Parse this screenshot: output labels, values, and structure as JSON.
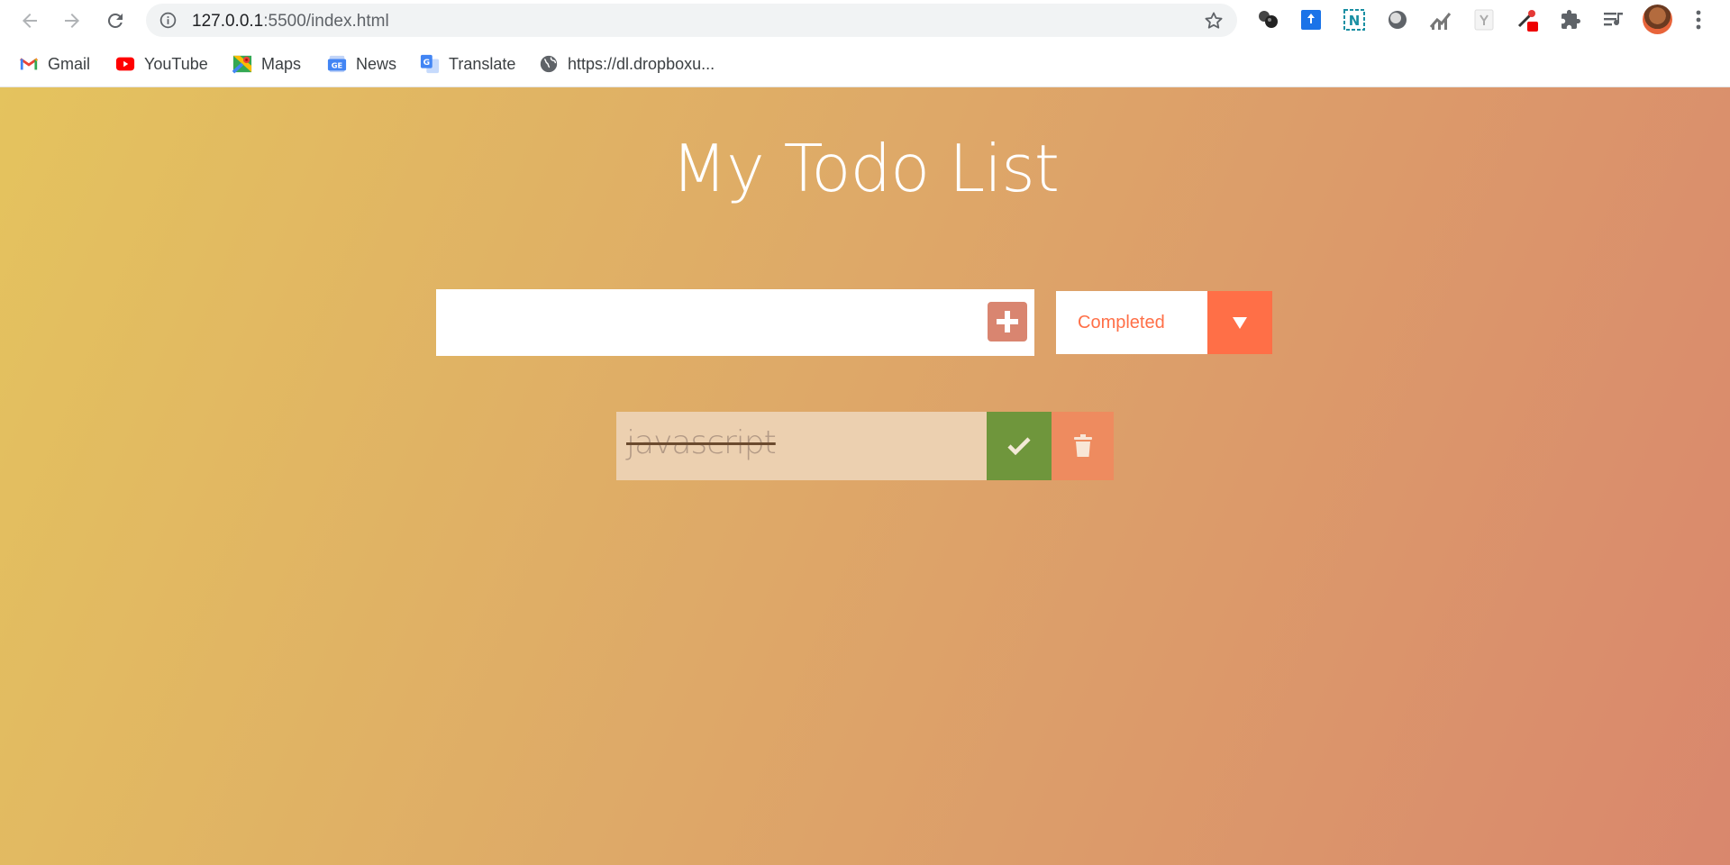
{
  "browser": {
    "url_host": "127.0.0.1",
    "url_rest": ":5500/index.html",
    "bookmarks": [
      {
        "label": "Gmail",
        "icon": "gmail-icon"
      },
      {
        "label": "YouTube",
        "icon": "youtube-icon"
      },
      {
        "label": "Maps",
        "icon": "maps-icon"
      },
      {
        "label": "News",
        "icon": "news-icon"
      },
      {
        "label": "Translate",
        "icon": "translate-icon"
      },
      {
        "label": "https://dl.dropboxu...",
        "icon": "globe-icon"
      }
    ]
  },
  "app": {
    "title": "My Todo List",
    "input_value": "",
    "filter_selected": "Completed",
    "todos": [
      {
        "text": "javascript",
        "completed": true
      }
    ]
  },
  "colors": {
    "gradient_start": "#e4c35e",
    "gradient_end": "#d9876d",
    "accent": "#ff6f47",
    "complete": "#6f963c",
    "trash": "#ee8b5f"
  }
}
